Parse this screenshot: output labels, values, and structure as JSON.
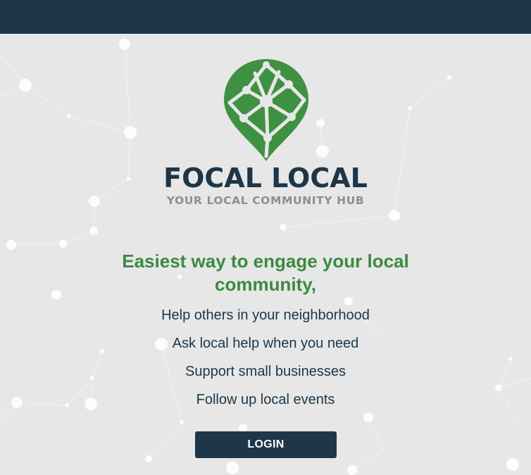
{
  "brand": {
    "name": "FOCAL LOCAL",
    "tagline": "YOUR LOCAL COMMUNITY HUB"
  },
  "hero": {
    "headline": "Easiest way to engage your local community,"
  },
  "features": [
    "Help others in your neighborhood",
    "Ask local help when you need",
    "Support small businesses",
    "Follow up local events"
  ],
  "actions": {
    "login_label": "LOGIN"
  },
  "colors": {
    "topbar": "#1e3647",
    "brand_green": "#3b8a40",
    "logo_green": "#3f9142",
    "background": "#e7e7e8",
    "tagline_gray": "#8e8e8e"
  }
}
